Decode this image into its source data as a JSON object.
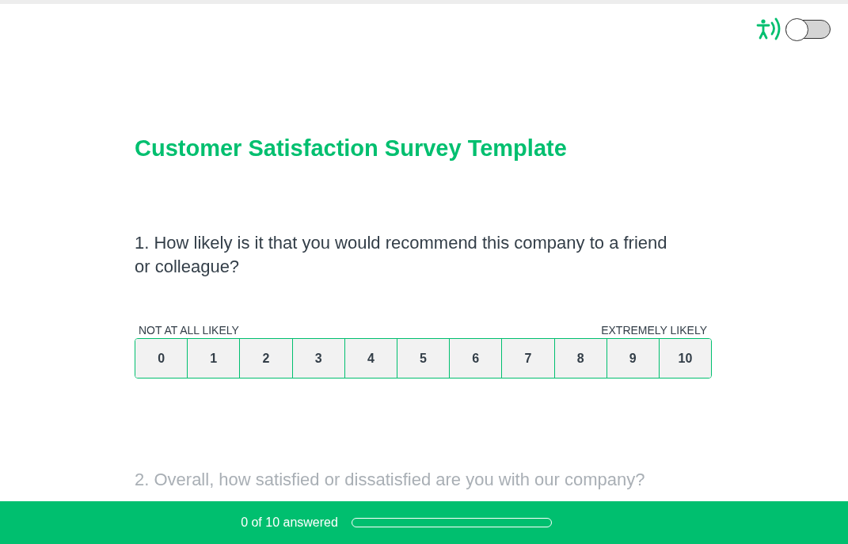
{
  "accessibility_toggle": {
    "on": false
  },
  "title": "Customer Satisfaction Survey Template",
  "questions": [
    {
      "text": "1. How likely is it that you would recommend this company to a friend or colleague?",
      "active": true,
      "kind": "scale",
      "low_label": "NOT AT ALL LIKELY",
      "high_label": "EXTREMELY LIKELY",
      "options": [
        {
          "label": "0",
          "selected": false
        },
        {
          "label": "1",
          "selected": false
        },
        {
          "label": "2",
          "selected": false
        },
        {
          "label": "3",
          "selected": false
        },
        {
          "label": "4",
          "selected": false
        },
        {
          "label": "5",
          "selected": false
        },
        {
          "label": "6",
          "selected": false
        },
        {
          "label": "7",
          "selected": false
        },
        {
          "label": "8",
          "selected": false
        },
        {
          "label": "9",
          "selected": false
        },
        {
          "label": "10",
          "selected": false
        }
      ]
    },
    {
      "text": "2. Overall, how satisfied or dissatisfied are you with our company?",
      "active": false,
      "kind": "text"
    }
  ],
  "footer": {
    "progress_text": "0 of 10 answered",
    "level": 0
  }
}
